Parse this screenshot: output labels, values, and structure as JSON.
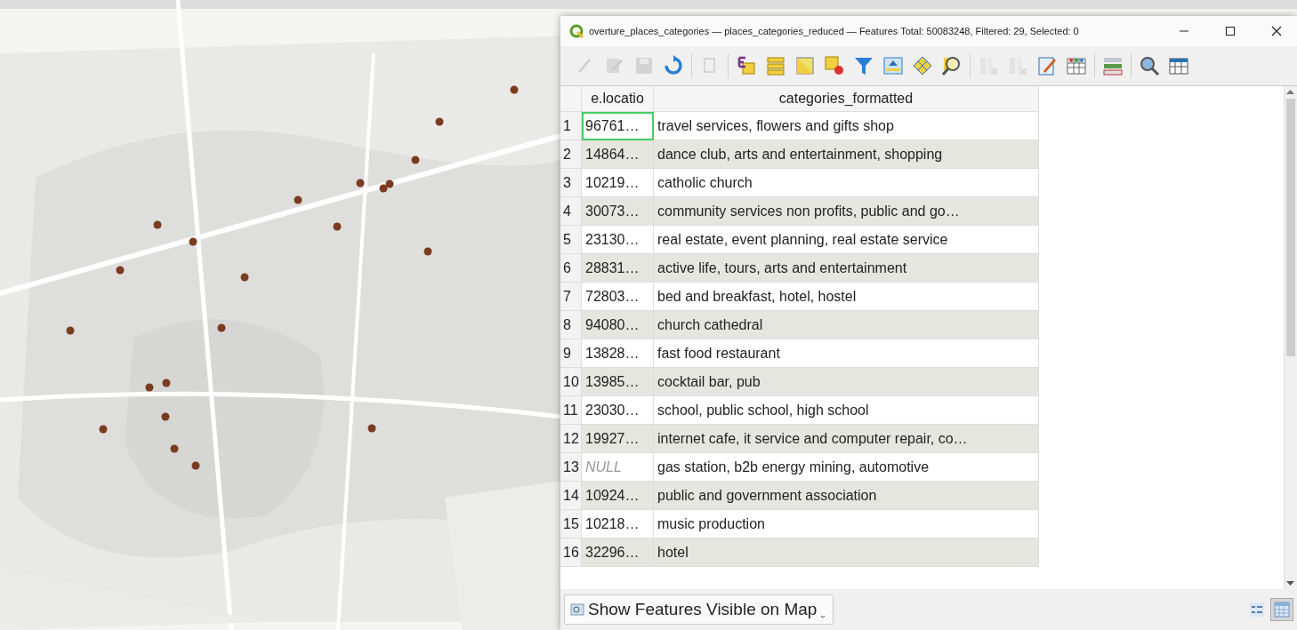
{
  "window": {
    "title": "overture_places_categories — places_categories_reduced — Features Total: 50083248, Filtered: 29, Selected: 0"
  },
  "toolbar": {
    "groups": [
      {
        "tools": [
          {
            "kind": "pencil",
            "disabled": true
          },
          {
            "kind": "multi-edit",
            "disabled": true
          },
          {
            "kind": "save",
            "disabled": true
          },
          {
            "kind": "reload",
            "disabled": false
          }
        ]
      },
      {
        "tools": [
          {
            "kind": "copy",
            "disabled": true
          }
        ]
      },
      {
        "tools": [
          {
            "kind": "expression",
            "disabled": false
          },
          {
            "kind": "select-all",
            "disabled": false
          },
          {
            "kind": "invert",
            "disabled": false
          },
          {
            "kind": "deselect",
            "disabled": false
          },
          {
            "kind": "filter",
            "disabled": false
          },
          {
            "kind": "move-top",
            "disabled": false
          },
          {
            "kind": "pan",
            "disabled": false
          },
          {
            "kind": "zoom",
            "disabled": false
          }
        ]
      },
      {
        "tools": [
          {
            "kind": "new-field",
            "disabled": true
          },
          {
            "kind": "delete-field",
            "disabled": true
          },
          {
            "kind": "field-calc",
            "disabled": false
          },
          {
            "kind": "conditional",
            "disabled": false
          }
        ]
      },
      {
        "tools": [
          {
            "kind": "organize",
            "disabled": false
          }
        ]
      },
      {
        "tools": [
          {
            "kind": "search",
            "disabled": false
          },
          {
            "kind": "dock",
            "disabled": false
          }
        ]
      }
    ]
  },
  "table": {
    "columns": [
      "e.locatio",
      "categories_formatted"
    ],
    "rows": [
      {
        "number": "1",
        "id": "96761…",
        "id_null": false,
        "current": true,
        "category": "travel services, flowers and gifts shop"
      },
      {
        "number": "2",
        "id": "14864…",
        "id_null": false,
        "current": false,
        "category": "dance club, arts and entertainment, shopping"
      },
      {
        "number": "3",
        "id": "10219…",
        "id_null": false,
        "current": false,
        "category": "catholic church"
      },
      {
        "number": "4",
        "id": "30073…",
        "id_null": false,
        "current": false,
        "category": "community services non profits, public and go…"
      },
      {
        "number": "5",
        "id": "23130…",
        "id_null": false,
        "current": false,
        "category": "real estate, event planning, real estate service"
      },
      {
        "number": "6",
        "id": "28831…",
        "id_null": false,
        "current": false,
        "category": "active life, tours, arts and entertainment"
      },
      {
        "number": "7",
        "id": "72803…",
        "id_null": false,
        "current": false,
        "category": "bed and breakfast, hotel, hostel"
      },
      {
        "number": "8",
        "id": "94080…",
        "id_null": false,
        "current": false,
        "category": "church cathedral"
      },
      {
        "number": "9",
        "id": "13828…",
        "id_null": false,
        "current": false,
        "category": "fast food restaurant"
      },
      {
        "number": "10",
        "id": "13985…",
        "id_null": false,
        "current": false,
        "category": "cocktail bar, pub"
      },
      {
        "number": "11",
        "id": "23030…",
        "id_null": false,
        "current": false,
        "category": "school, public school, high school"
      },
      {
        "number": "12",
        "id": "19927…",
        "id_null": false,
        "current": false,
        "category": "internet cafe, it service and computer repair, co…"
      },
      {
        "number": "13",
        "id": "NULL",
        "id_null": true,
        "current": false,
        "category": "gas station, b2b energy mining, automotive"
      },
      {
        "number": "14",
        "id": "10924…",
        "id_null": false,
        "current": false,
        "category": "public and government association"
      },
      {
        "number": "15",
        "id": "10218…",
        "id_null": false,
        "current": false,
        "category": "music production"
      },
      {
        "number": "16",
        "id": "32296…",
        "id_null": false,
        "current": false,
        "category": "hotel"
      }
    ]
  },
  "filter_button": {
    "label": "Show Features Visible on Map"
  },
  "view_buttons": [
    {
      "kind": "form",
      "selected": false
    },
    {
      "kind": "table",
      "selected": true
    }
  ]
}
